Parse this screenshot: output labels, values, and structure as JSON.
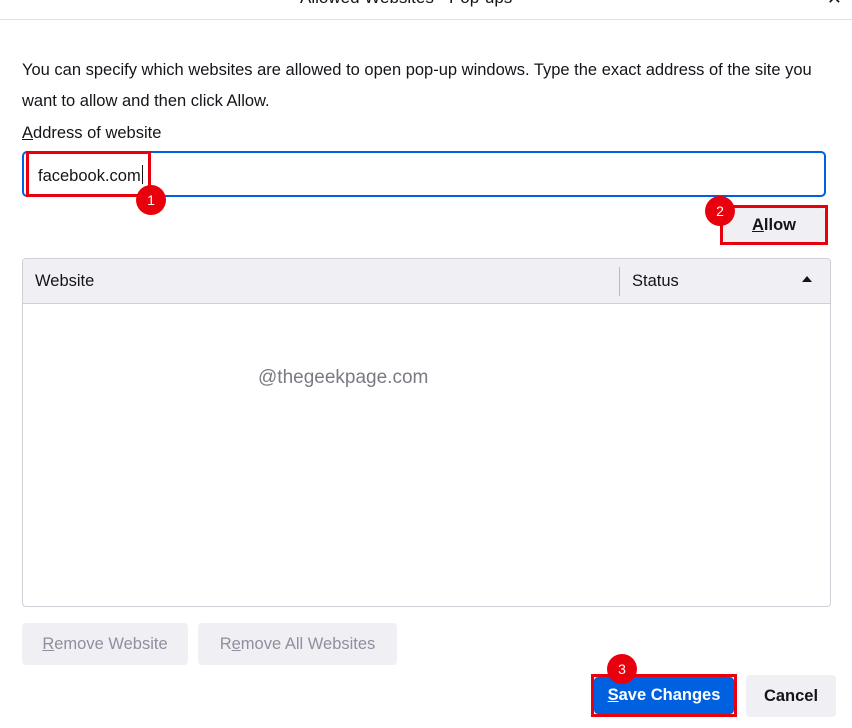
{
  "dialog": {
    "title": "Allowed Websites - Pop-ups"
  },
  "description": "You can specify which websites are allowed to open pop-up windows. Type the exact address of the site you want to allow and then click Allow.",
  "address_field": {
    "label_access_key": "A",
    "label_rest": "ddress of website",
    "value": "facebook.com"
  },
  "allow_button": {
    "access_key": "A",
    "label_rest": "llow"
  },
  "table": {
    "columns": [
      "Website",
      "Status"
    ],
    "rows": [],
    "sort": "ascending"
  },
  "watermark": "@thegeekpage.com",
  "buttons": {
    "remove_website": {
      "access_key": "R",
      "label_rest": "emove Website"
    },
    "remove_all": {
      "prefix": "R",
      "access_key": "e",
      "label_rest": "move All Websites"
    },
    "save_changes": {
      "access_key": "S",
      "label_rest": "ave Changes"
    },
    "cancel": "Cancel"
  },
  "annotations": [
    "1",
    "2",
    "3"
  ],
  "colors": {
    "accent": "#0061e0",
    "annotation_red": "#e8000d",
    "button_bg": "#f0f0f4",
    "disabled_text": "#8f8f9d"
  }
}
